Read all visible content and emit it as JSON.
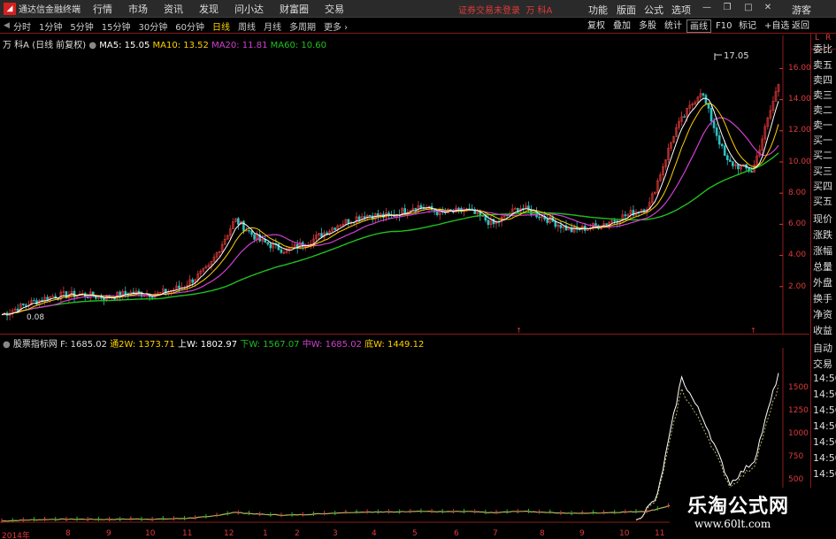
{
  "app": {
    "name": "通达信金融终端",
    "notice": "证券交易未登录",
    "stock": "万 科A"
  },
  "menu": [
    "行情",
    "市场",
    "资讯",
    "发现",
    "问小达",
    "财富圈",
    "交易"
  ],
  "right_menu": [
    "功能",
    "版面",
    "公式",
    "选项",
    "游客"
  ],
  "periods": [
    "分时",
    "1分钟",
    "5分钟",
    "15分钟",
    "30分钟",
    "60分钟",
    "日线",
    "周线",
    "月线",
    "多周期",
    "更多 ›"
  ],
  "active_period": "日线",
  "tool_right": [
    "复权",
    "叠加",
    "多股",
    "统计",
    "画线",
    "F10",
    "标记",
    "+自选",
    "返回"
  ],
  "ma": {
    "title": "万 科A (日线 前复权)",
    "ma5": "MA5: 15.05",
    "ma10": "MA10: 13.52",
    "ma20": "MA20: 11.81",
    "ma60": "MA60: 10.60"
  },
  "ind": {
    "title": "股票指标网",
    "f": "F: 1685.02",
    "tong": "通2W: 1373.71",
    "shang": "上W: 1802.97",
    "xia": "下W: 1567.07",
    "zhong": "中W: 1685.02",
    "di": "底W: 1449.12"
  },
  "price_axis": [
    "16.00",
    "14.00",
    "12.00",
    "10.00",
    "8.00",
    "6.00",
    "4.00",
    "2.00"
  ],
  "ind_axis": [
    "1500",
    "1250",
    "1000",
    "750",
    "500"
  ],
  "x_labels": [
    "2014年",
    "8",
    "9",
    "10",
    "11",
    "12",
    "1",
    "2",
    "3",
    "4",
    "5",
    "6",
    "7",
    "8",
    "9",
    "10",
    "11"
  ],
  "high_label": "17.05",
  "low_label": "0.08",
  "right_panel": {
    "top": [
      "L",
      "R"
    ],
    "items": [
      "委比",
      "卖五",
      "卖四",
      "卖三",
      "卖二",
      "卖一",
      "买一",
      "买二",
      "买三",
      "买四",
      "买五",
      "现价",
      "涨跌",
      "涨幅",
      "总量",
      "外盘",
      "换手",
      "净资",
      "收益",
      "自动",
      "交易"
    ],
    "times": [
      "14:50",
      "14:50",
      "14:50",
      "14:50",
      "14:50",
      "14:50",
      "14:50"
    ]
  },
  "watermark": {
    "title": "乐淘公式网",
    "url": "www.60lt.com"
  },
  "colors": {
    "up": "#e03a3a",
    "ma5": "#ffffff",
    "ma10": "#ffd000",
    "ma20": "#d040d0",
    "ma60": "#20c020",
    "indicator": "#b8b060"
  },
  "chart_data": {
    "type": "line",
    "title": "万 科A (日线 前复权)",
    "ylim": [
      0,
      17.5
    ],
    "series": [
      {
        "name": "MA60",
        "values": [
          0.3,
          0.6,
          1.0,
          1.4,
          1.5,
          1.7,
          2.1,
          3.0,
          4.0,
          4.6,
          5.2,
          5.5,
          5.9,
          6.0,
          6.1,
          6.3,
          6.5,
          7.2,
          9.5,
          10.6
        ]
      },
      {
        "name": "MA5",
        "values": [
          0.2,
          1.0,
          1.5,
          1.3,
          1.6,
          1.5,
          3.5,
          6.2,
          4.5,
          5.5,
          6.6,
          7.2,
          6.8,
          7.1,
          5.8,
          5.6,
          6.6,
          7.5,
          14.5,
          9.5,
          15.05
        ]
      }
    ]
  }
}
